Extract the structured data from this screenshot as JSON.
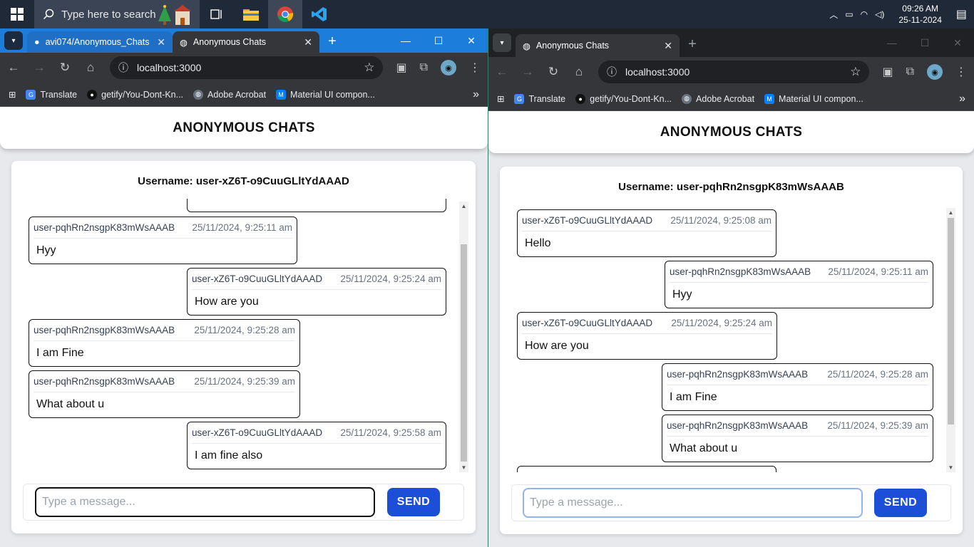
{
  "taskbar": {
    "search_placeholder": "Type here to search",
    "time": "09:26 AM",
    "date": "25-11-2024"
  },
  "left_window": {
    "tabs": [
      {
        "label": "avi074/Anonymous_Chats"
      },
      {
        "label": "Anonymous Chats"
      }
    ],
    "url": "localhost:3000",
    "bookmarks": [
      "Translate",
      "getify/You-Dont-Kn...",
      "Adobe Acrobat",
      "Material UI compon..."
    ],
    "app": {
      "title": "ANONYMOUS CHATS",
      "username": "Username: user-xZ6T-o9CuuGLltYdAAAD",
      "messages": [
        {
          "user": "user-pqhRn2nsgpK83mWsAAAB",
          "time": "25/11/2024, 9:25:11 am",
          "text": "Hyy"
        },
        {
          "user": "user-xZ6T-o9CuuGLltYdAAAD",
          "time": "25/11/2024, 9:25:24 am",
          "text": "How are you"
        },
        {
          "user": "user-pqhRn2nsgpK83mWsAAAB",
          "time": "25/11/2024, 9:25:28 am",
          "text": "I am Fine"
        },
        {
          "user": "user-pqhRn2nsgpK83mWsAAAB",
          "time": "25/11/2024, 9:25:39 am",
          "text": "What about u"
        },
        {
          "user": "user-xZ6T-o9CuuGLltYdAAAD",
          "time": "25/11/2024, 9:25:58 am",
          "text": "I am fine also"
        }
      ],
      "input_placeholder": "Type a message...",
      "send_label": "SEND"
    }
  },
  "right_window": {
    "tabs": [
      {
        "label": "Anonymous Chats"
      }
    ],
    "url": "localhost:3000",
    "bookmarks": [
      "Translate",
      "getify/You-Dont-Kn...",
      "Adobe Acrobat",
      "Material UI compon..."
    ],
    "app": {
      "title": "ANONYMOUS CHATS",
      "username": "Username: user-pqhRn2nsgpK83mWsAAAB",
      "messages": [
        {
          "user": "user-xZ6T-o9CuuGLltYdAAAD",
          "time": "25/11/2024, 9:25:08 am",
          "text": "Hello"
        },
        {
          "user": "user-pqhRn2nsgpK83mWsAAAB",
          "time": "25/11/2024, 9:25:11 am",
          "text": "Hyy"
        },
        {
          "user": "user-xZ6T-o9CuuGLltYdAAAD",
          "time": "25/11/2024, 9:25:24 am",
          "text": "How are you"
        },
        {
          "user": "user-pqhRn2nsgpK83mWsAAAB",
          "time": "25/11/2024, 9:25:28 am",
          "text": "I am Fine"
        },
        {
          "user": "user-pqhRn2nsgpK83mWsAAAB",
          "time": "25/11/2024, 9:25:39 am",
          "text": "What about u"
        }
      ],
      "input_placeholder": "Type a message...",
      "send_label": "SEND"
    }
  },
  "colors": {
    "send_button": "#1d4ed8",
    "taskbar": "#1f2937",
    "tabstrip_active_window": "#1c7ddb"
  }
}
